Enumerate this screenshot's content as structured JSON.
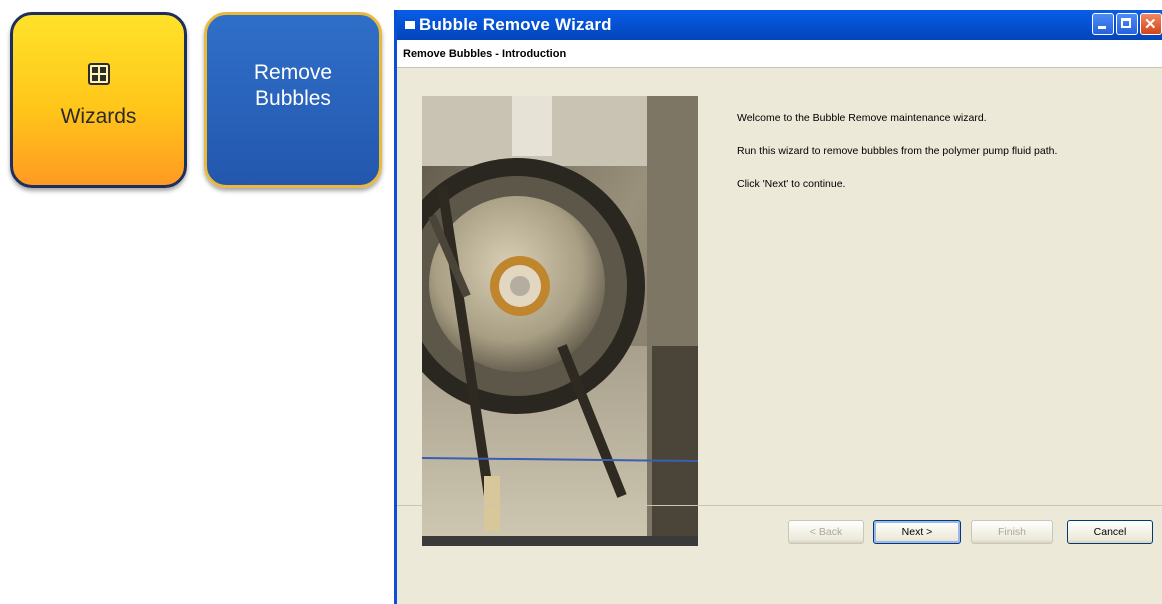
{
  "tiles": {
    "wizards": {
      "label": "Wizards",
      "icon": "grid-icon",
      "color": "#ffc619"
    },
    "remove_bubbles": {
      "label": "Remove\nBubbles",
      "color": "#2357ad"
    }
  },
  "window": {
    "title": "Bubble Remove Wizard",
    "header": "Remove Bubbles - Introduction",
    "accent": "#0553d6",
    "titlebar_buttons": [
      "minimize-icon",
      "maximize-icon",
      "close-icon"
    ]
  },
  "instructions": {
    "line1": "Welcome to the Bubble Remove maintenance wizard.",
    "line2": "Run this wizard to remove bubbles from the polymer pump fluid path.",
    "line3": "Click 'Next' to continue."
  },
  "footer": {
    "back": "< Back",
    "next": "Next >",
    "finish": "Finish",
    "cancel": "Cancel"
  }
}
